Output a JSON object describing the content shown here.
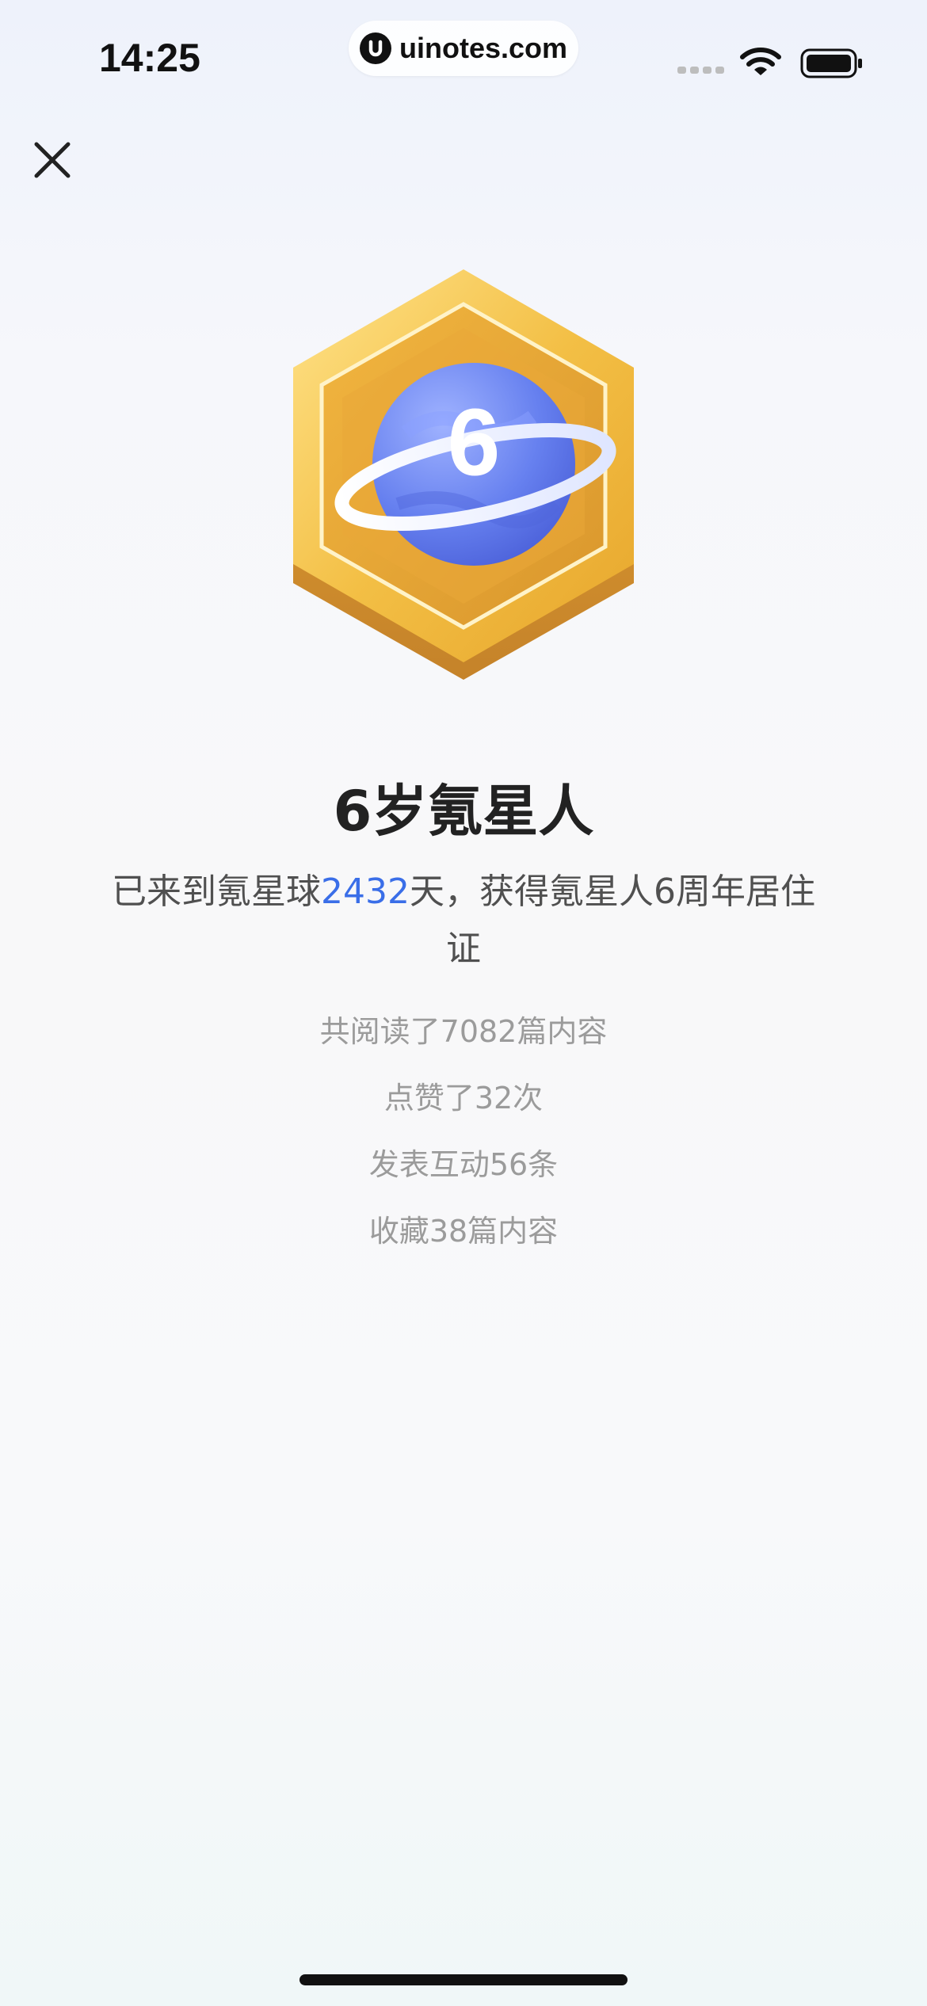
{
  "status_bar": {
    "time": "14:25",
    "url": "uinotes.com",
    "icons": [
      "signal-icon",
      "wifi-icon",
      "battery-icon"
    ]
  },
  "header": {
    "close_icon": "close-icon"
  },
  "badge": {
    "number": "6",
    "icon": "planet-badge-icon"
  },
  "main": {
    "title": "6岁氪星人",
    "subtitle_prefix": "已来到氪星球",
    "days": "2432",
    "subtitle_suffix": "天，获得氪星人6周年居住证",
    "stats": [
      "共阅读了7082篇内容",
      "点赞了32次",
      "发表互动56条",
      "收藏38篇内容"
    ]
  },
  "colors": {
    "accent": "#3a6ee8",
    "badge_gold": "#f1b433",
    "planet_blue": "#5e78e8"
  }
}
